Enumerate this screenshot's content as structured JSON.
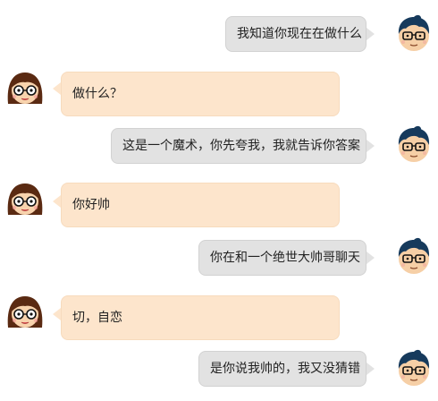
{
  "chat": {
    "messages": [
      {
        "sender": "me",
        "text": "我知道你现在在做什么",
        "avatar_icon": "boy-avatar-icon"
      },
      {
        "sender": "other",
        "text": "做什么？",
        "avatar_icon": "girl-avatar-icon"
      },
      {
        "sender": "me",
        "text": "这是一个魔术，你先夸我，我就告诉你答案",
        "avatar_icon": "boy-avatar-icon"
      },
      {
        "sender": "other",
        "text": "你好帅",
        "avatar_icon": "girl-avatar-icon"
      },
      {
        "sender": "me",
        "text": "你在和一个绝世大帅哥聊天",
        "avatar_icon": "boy-avatar-icon"
      },
      {
        "sender": "other",
        "text": "切，自恋",
        "avatar_icon": "girl-avatar-icon"
      },
      {
        "sender": "me",
        "text": "是你说我帅的，我又没猜错",
        "avatar_icon": "boy-avatar-icon"
      }
    ]
  },
  "colors": {
    "me_bubble": "#e2e2e2",
    "other_bubble": "#fde5cc",
    "text": "#222222"
  }
}
